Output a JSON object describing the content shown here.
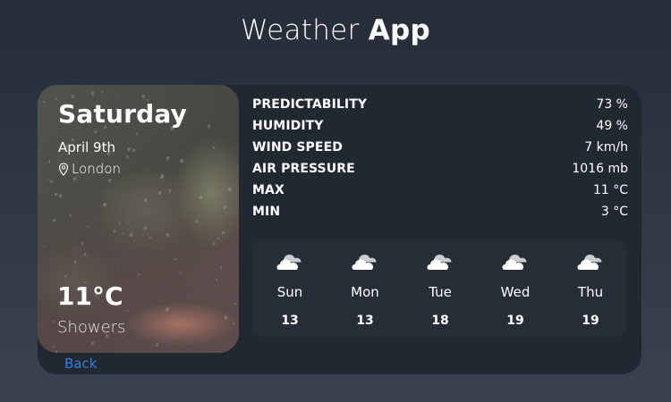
{
  "app": {
    "title_light": "Weather",
    "title_bold": "App"
  },
  "current": {
    "day": "Saturday",
    "date": "April 9th",
    "location": "London",
    "temperature": "11°C",
    "condition": "Showers"
  },
  "stats": [
    {
      "label": "PREDICTABILITY",
      "value": "73 %"
    },
    {
      "label": "HUMIDITY",
      "value": "49 %"
    },
    {
      "label": "WIND SPEED",
      "value": "7 km/h"
    },
    {
      "label": "AIR PRESSURE",
      "value": "1016 mb"
    },
    {
      "label": "MAX",
      "value": "11 °C"
    },
    {
      "label": "MIN",
      "value": "3 °C"
    }
  ],
  "forecast": [
    {
      "day": "Sun",
      "temp": "13",
      "icon": "cloud-icon"
    },
    {
      "day": "Mon",
      "temp": "13",
      "icon": "cloud-icon"
    },
    {
      "day": "Tue",
      "temp": "18",
      "icon": "cloud-icon"
    },
    {
      "day": "Wed",
      "temp": "19",
      "icon": "cloud-icon"
    },
    {
      "day": "Thu",
      "temp": "19",
      "icon": "cloud-icon"
    }
  ],
  "nav": {
    "back_label": "Back"
  },
  "colors": {
    "card_bg": "#222831",
    "link": "#2f7de1",
    "text": "#ffffff"
  }
}
